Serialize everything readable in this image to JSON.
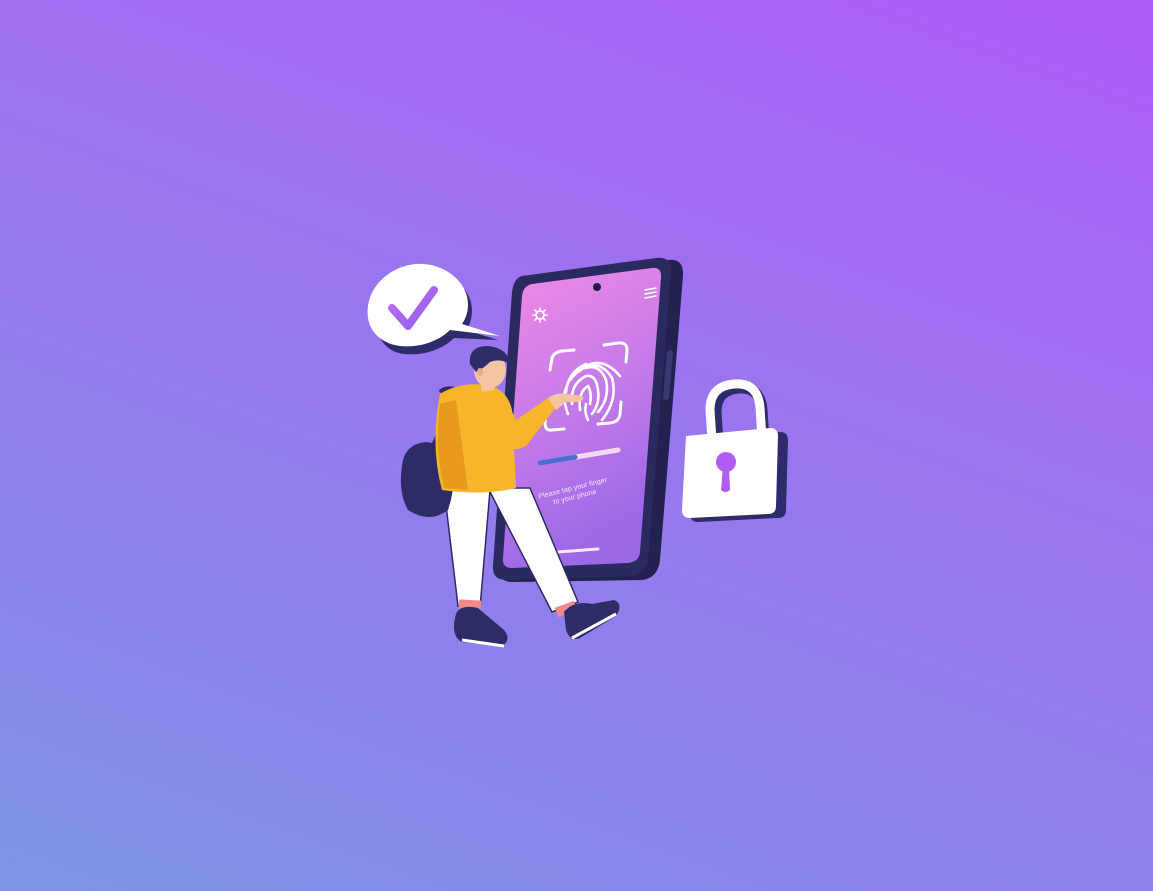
{
  "illustration": {
    "phone_prompt_line1": "Please tap your finger",
    "phone_prompt_line2": "to your phone",
    "scan_progress": 0.45,
    "icons": [
      "checkmark-icon",
      "fingerprint-icon",
      "settings-icon",
      "menu-icon",
      "padlock-icon"
    ]
  },
  "colors": {
    "background_top": "#ad5cf6",
    "background_bottom": "#7e95e6",
    "phone_body": "#2b2a5e",
    "phone_screen_top": "#f28ae6",
    "phone_screen_bottom": "#9b68e6",
    "jacket": "#f7b52c",
    "pants": "#ffffff",
    "shoes": "#2e2c66",
    "accent": "#b15cf2"
  }
}
